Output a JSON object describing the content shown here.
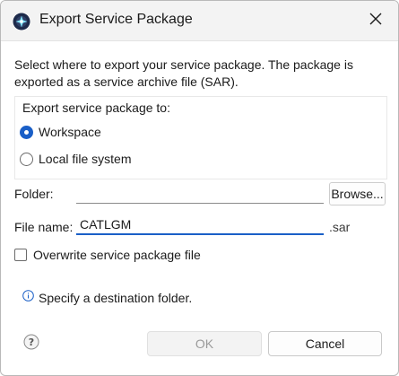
{
  "window": {
    "title": "Export Service Package",
    "close_icon": "close-icon",
    "app_icon": "eclipse-icon"
  },
  "description": "Select where to export your service package. The package is exported as a service archive file (SAR).",
  "export_to": {
    "group_label": "Export service package to:",
    "options": [
      {
        "label": "Workspace",
        "selected": true
      },
      {
        "label": "Local file system",
        "selected": false
      }
    ]
  },
  "folder": {
    "label": "Folder:",
    "value": "",
    "browse_label": "Browse..."
  },
  "file_name": {
    "label": "File name:",
    "value": "CATLGM",
    "extension": ".sar"
  },
  "overwrite": {
    "label": "Overwrite service package file",
    "checked": false
  },
  "message": {
    "icon": "info-icon",
    "text": "Specify a destination folder."
  },
  "footer": {
    "help_icon": "help-icon",
    "ok_label": "OK",
    "ok_enabled": false,
    "cancel_label": "Cancel"
  },
  "colors": {
    "accent": "#1a5fc7",
    "title_bar": "#f3f3f3",
    "disabled_text": "#9a9a9a"
  }
}
